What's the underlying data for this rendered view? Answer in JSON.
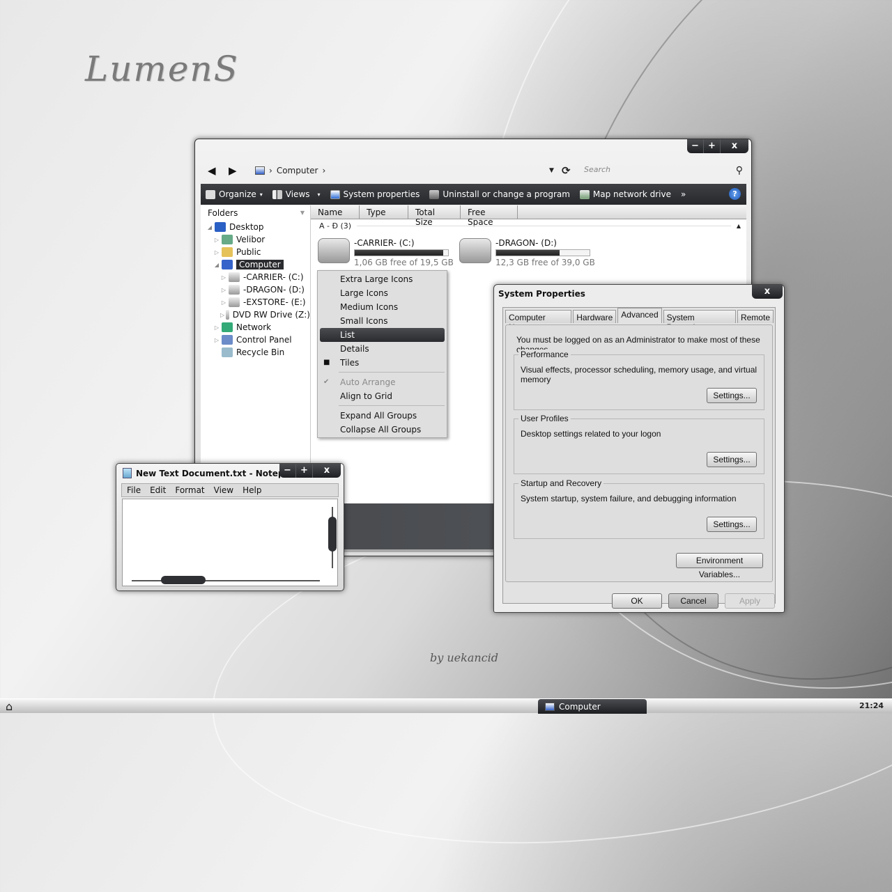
{
  "desktop": {
    "logo": "LumenS",
    "signature": "by uekancid"
  },
  "explorer": {
    "window_controls": [
      "−",
      "+",
      "x"
    ],
    "address": {
      "crumbs": [
        "Computer"
      ],
      "search_placeholder": "Search"
    },
    "toolbar": [
      {
        "label": "Organize",
        "icon": "organize-icon",
        "dropdown": true
      },
      {
        "label": "Views",
        "icon": "views-icon",
        "dropdown": true
      },
      {
        "label": "System properties",
        "icon": "system-properties-icon"
      },
      {
        "label": "Uninstall or change a program",
        "icon": "uninstall-icon"
      },
      {
        "label": "Map network drive",
        "icon": "map-drive-icon"
      },
      {
        "label": "»",
        "icon": "overflow-icon"
      }
    ],
    "help": "?",
    "folders_header": "Folders",
    "tree": [
      {
        "label": "Desktop",
        "indent": 0,
        "expanded": true
      },
      {
        "label": "Velibor",
        "indent": 1
      },
      {
        "label": "Public",
        "indent": 1
      },
      {
        "label": "Computer",
        "indent": 1,
        "expanded": true,
        "selected": true
      },
      {
        "label": "-CARRIER- (C:)",
        "indent": 2
      },
      {
        "label": "-DRAGON- (D:)",
        "indent": 2
      },
      {
        "label": "-EXSTORE- (E:)",
        "indent": 2
      },
      {
        "label": "DVD RW Drive (Z:)",
        "indent": 2
      },
      {
        "label": "Network",
        "indent": 1
      },
      {
        "label": "Control Panel",
        "indent": 1
      },
      {
        "label": "Recycle Bin",
        "indent": 1
      }
    ],
    "columns": [
      "Name",
      "Type",
      "Total Size",
      "Free Space"
    ],
    "group": {
      "label": "A - Đ (3)"
    },
    "drives": [
      {
        "name": "-CARRIER- (C:)",
        "free_text": "1,06 GB free of 19,5 GB",
        "used_fraction": 0.95
      },
      {
        "name": "-DRAGON- (D:)",
        "free_text": "12,3 GB free of 39,0 GB",
        "used_fraction": 0.68
      }
    ]
  },
  "context_menu": {
    "items": [
      {
        "label": "Extra Large Icons"
      },
      {
        "label": "Large Icons"
      },
      {
        "label": "Medium Icons"
      },
      {
        "label": "Small Icons"
      },
      {
        "label": "List",
        "highlighted": true
      },
      {
        "label": "Details"
      },
      {
        "label": "Tiles",
        "bullet": true
      },
      {
        "separator": true
      },
      {
        "label": "Auto Arrange",
        "checked": true,
        "disabled": true
      },
      {
        "label": "Align to Grid"
      },
      {
        "separator": true
      },
      {
        "label": "Expand All Groups"
      },
      {
        "label": "Collapse All Groups"
      }
    ]
  },
  "system_properties": {
    "title": "System Properties",
    "close": "x",
    "tabs": [
      "Computer Name",
      "Hardware",
      "Advanced",
      "System Protection",
      "Remote"
    ],
    "active_tab": "Advanced",
    "note": "You must be logged on as an Administrator to make most of these changes.",
    "groups": [
      {
        "legend": "Performance",
        "desc": "Visual effects, processor scheduling, memory usage, and virtual memory",
        "button": "Settings..."
      },
      {
        "legend": "User Profiles",
        "desc": "Desktop settings related to your logon",
        "button": "Settings..."
      },
      {
        "legend": "Startup and Recovery",
        "desc": "System startup, system failure, and debugging information",
        "button": "Settings..."
      }
    ],
    "env_button": "Environment Variables...",
    "ok": "OK",
    "cancel": "Cancel",
    "apply": "Apply"
  },
  "notepad": {
    "title": "New Text Document.txt - Notepad",
    "window_controls": [
      "−",
      "+",
      "x"
    ],
    "menu": [
      "File",
      "Edit",
      "Format",
      "View",
      "Help"
    ],
    "content": ""
  },
  "taskbar": {
    "tasks": [
      {
        "label": "Computer",
        "icon": "computer-icon"
      }
    ],
    "clock": "21:24"
  }
}
